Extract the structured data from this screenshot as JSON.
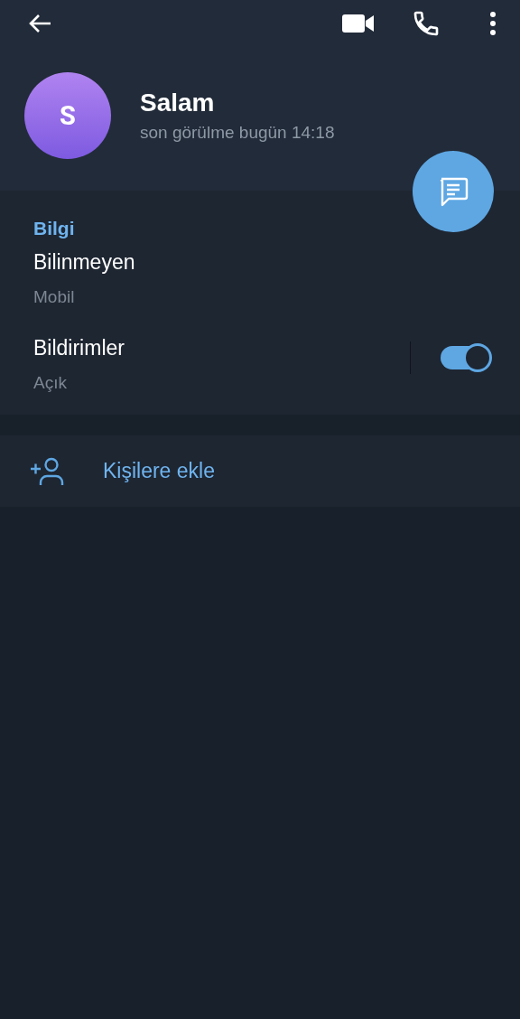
{
  "profile": {
    "avatar_letter": "S",
    "name": "Salam",
    "status": "son görülme bugün 14:18"
  },
  "info": {
    "title": "Bilgi",
    "rows": [
      {
        "kind": "text",
        "value": "Bilinmeyen",
        "label": "Mobil"
      },
      {
        "kind": "toggle",
        "value": "Bildirimler",
        "label": "Açık",
        "on": true
      }
    ]
  },
  "action": {
    "label": "Kişilere ekle"
  }
}
